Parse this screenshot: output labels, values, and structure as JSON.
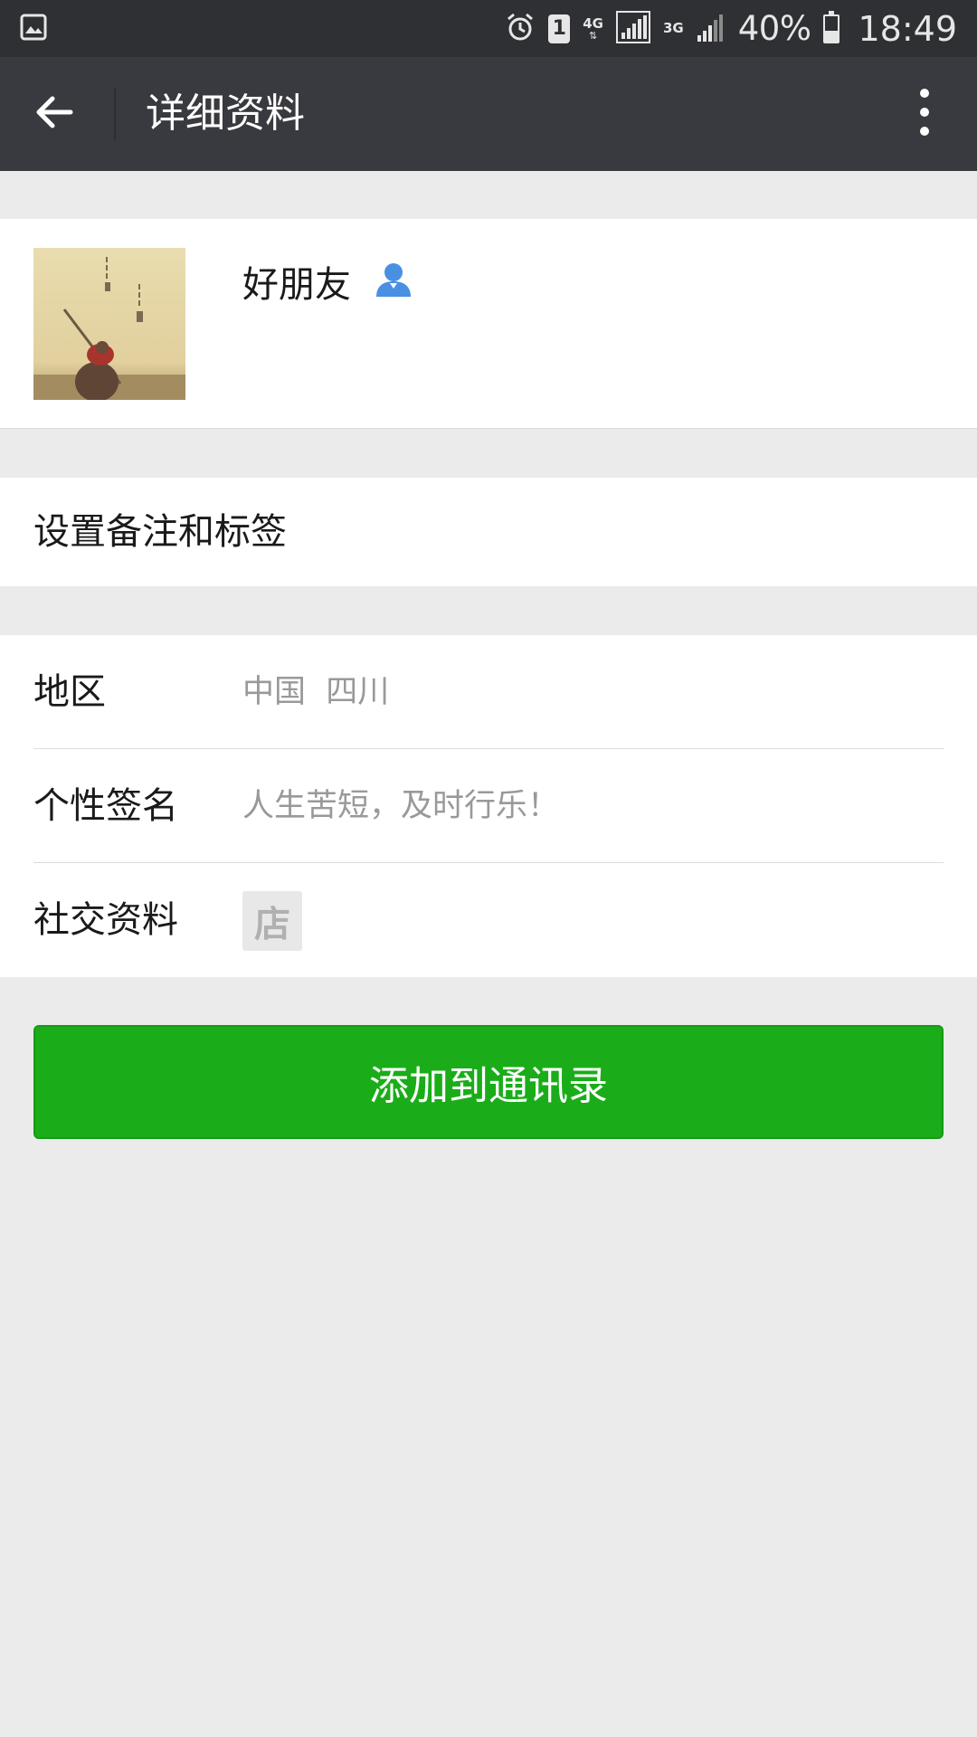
{
  "status_bar": {
    "sim_slot": "1",
    "network_1": "4G",
    "network_2": "3G",
    "battery": "40%",
    "battery_level": 0.4,
    "time": "18:49"
  },
  "app_bar": {
    "title": "详细资料",
    "back_icon": "arrow-left-icon",
    "more_icon": "more-vertical-icon"
  },
  "profile": {
    "nickname": "好朋友",
    "contact_icon": "person-icon",
    "contact_icon_color": "#4a90e2"
  },
  "remark": {
    "label": "设置备注和标签"
  },
  "info": {
    "region_label": "地区",
    "region_value": "中国  四川",
    "signature_label": "个性签名",
    "signature_value": "人生苦短，及时行乐！",
    "social_label": "社交资料",
    "social_icon_text": "店"
  },
  "actions": {
    "add_label": "添加到通讯录",
    "add_color": "#1aad19"
  }
}
